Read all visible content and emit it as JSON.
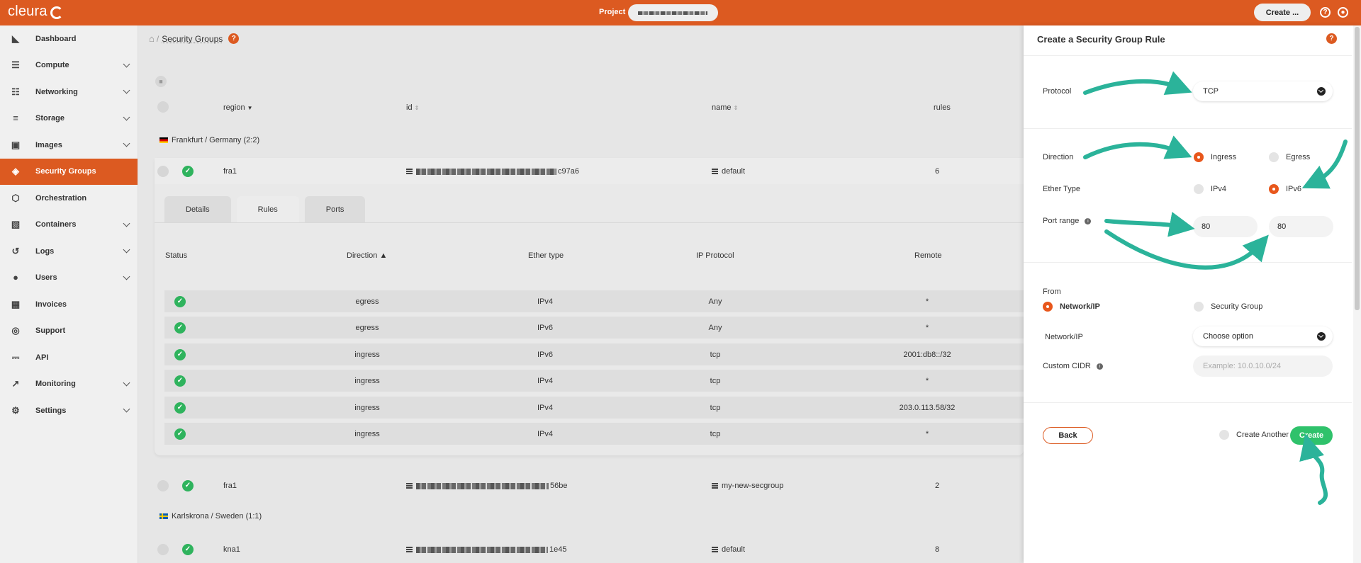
{
  "topbar": {
    "logo": "cleura",
    "project_label": "Project",
    "create_button": "Create ...",
    "help_icon": "?"
  },
  "sidebar": {
    "items": [
      {
        "label": "Dashboard",
        "icon": "chart-area-icon",
        "glyph": "◣"
      },
      {
        "label": "Compute",
        "icon": "server-icon",
        "glyph": "☰"
      },
      {
        "label": "Networking",
        "icon": "sitemap-icon",
        "glyph": "☷"
      },
      {
        "label": "Storage",
        "icon": "database-icon",
        "glyph": "≡"
      },
      {
        "label": "Images",
        "icon": "camera-icon",
        "glyph": "▣"
      },
      {
        "label": "Security Groups",
        "icon": "shield-icon",
        "glyph": "◈"
      },
      {
        "label": "Orchestration",
        "icon": "hexagon-icon",
        "glyph": "⬡"
      },
      {
        "label": "Containers",
        "icon": "cube-icon",
        "glyph": "▧"
      },
      {
        "label": "Logs",
        "icon": "history-icon",
        "glyph": "↺"
      },
      {
        "label": "Users",
        "icon": "user-icon",
        "glyph": "●"
      },
      {
        "label": "Invoices",
        "icon": "calculator-icon",
        "glyph": "▦"
      },
      {
        "label": "Support",
        "icon": "lifebuoy-icon",
        "glyph": "◎"
      },
      {
        "label": "API",
        "icon": "plug-icon",
        "glyph": "⎓"
      },
      {
        "label": "Monitoring",
        "icon": "chart-line-icon",
        "glyph": "↗"
      },
      {
        "label": "Settings",
        "icon": "gear-icon",
        "glyph": "⚙"
      }
    ],
    "active": "Security Groups"
  },
  "breadcrumb": {
    "title": "Security Groups",
    "help": "?"
  },
  "table": {
    "headers": {
      "region": "region",
      "id": "id",
      "name": "name",
      "rules": "rules"
    },
    "groups": [
      {
        "label": "Frankfurt / Germany",
        "count": "(2:2)"
      },
      {
        "label": "Karlskrona / Sweden",
        "count": "(1:1)"
      }
    ],
    "rows": [
      {
        "region": "fra1",
        "id_suffix": "c97a6",
        "name": "default",
        "rules": "6"
      },
      {
        "region": "fra1",
        "id_suffix": "56be",
        "name": "my-new-secgroup",
        "rules": "2"
      },
      {
        "region": "kna1",
        "id_suffix": "1e45",
        "name": "default",
        "rules": "8"
      }
    ]
  },
  "detail": {
    "tabs": [
      "Details",
      "Rules",
      "Ports"
    ],
    "active_tab": "Rules",
    "headers": {
      "status": "Status",
      "direction": "Direction",
      "ether": "Ether type",
      "proto": "IP Protocol",
      "remote": "Remote"
    },
    "rules": [
      {
        "direction": "egress",
        "ether": "IPv4",
        "proto": "Any",
        "remote": "*"
      },
      {
        "direction": "egress",
        "ether": "IPv6",
        "proto": "Any",
        "remote": "*"
      },
      {
        "direction": "ingress",
        "ether": "IPv6",
        "proto": "tcp",
        "remote": "2001:db8::/32"
      },
      {
        "direction": "ingress",
        "ether": "IPv4",
        "proto": "tcp",
        "remote": "*"
      },
      {
        "direction": "ingress",
        "ether": "IPv4",
        "proto": "tcp",
        "remote": "203.0.113.58/32"
      },
      {
        "direction": "ingress",
        "ether": "IPv4",
        "proto": "tcp",
        "remote": "*"
      }
    ]
  },
  "panel": {
    "title": "Create a Security Group Rule",
    "protocol_label": "Protocol",
    "protocol_value": "TCP",
    "direction_label": "Direction",
    "direction_options": [
      "Ingress",
      "Egress"
    ],
    "direction_selected": "Ingress",
    "ether_label": "Ether Type",
    "ether_options": [
      "IPv4",
      "IPv6"
    ],
    "ether_selected": "IPv6",
    "port_label": "Port range",
    "port_from": "80",
    "port_to": "80",
    "from_label": "From",
    "from_options": [
      "Network/IP",
      "Security Group"
    ],
    "from_selected": "Network/IP",
    "network_label": "Network/IP",
    "network_value": "Choose option",
    "cidr_label": "Custom CIDR",
    "cidr_placeholder": "Example: 10.0.10.0/24",
    "back_button": "Back",
    "create_another": "Create Another",
    "create_button": "Create"
  },
  "colors": {
    "brand": "#dc5a21",
    "success": "#2fc26b",
    "arrow": "#2bb39a"
  }
}
